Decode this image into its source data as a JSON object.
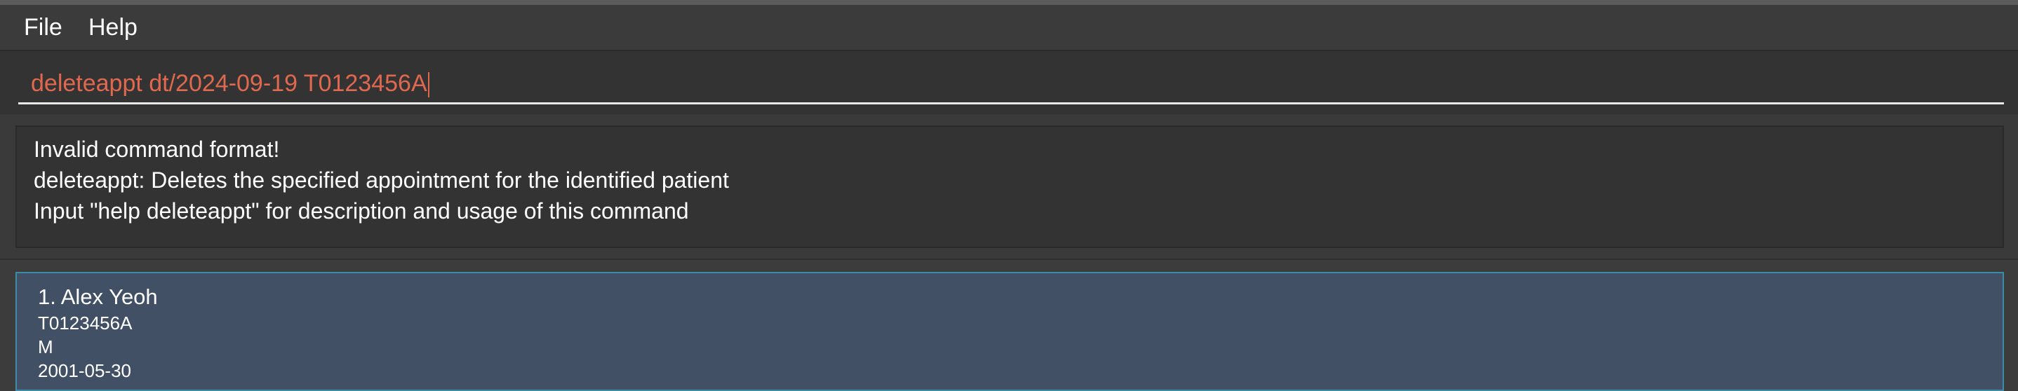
{
  "menu": {
    "file": "File",
    "help": "Help"
  },
  "command": {
    "value": "deleteappt dt/2024-09-19 T0123456A",
    "text_color": "#e0684f"
  },
  "result": {
    "lines": [
      "Invalid command format!",
      "deleteappt: Deletes the specified appointment for the identified patient",
      "Input \"help deleteappt\" for description and usage of this command"
    ]
  },
  "patients": [
    {
      "index_name": "1. Alex Yeoh",
      "nric": "T0123456A",
      "sex": "M",
      "dob": "2001-05-30"
    }
  ],
  "colors": {
    "background": "#3c3c3c",
    "card": "#425066",
    "card_border": "#3a8ca8",
    "command_text": "#e0684f"
  }
}
